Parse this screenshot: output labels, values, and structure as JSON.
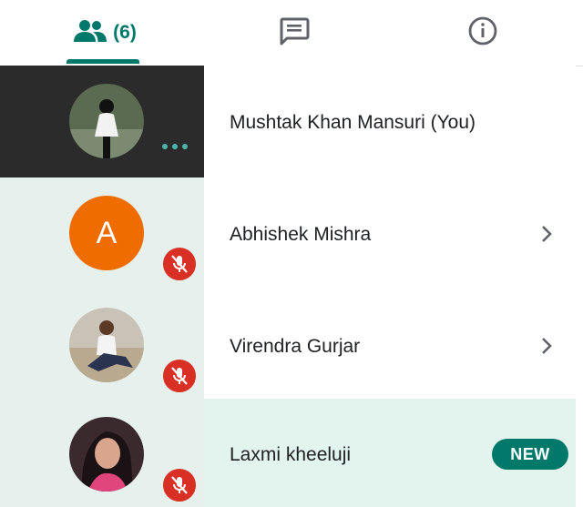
{
  "tabs": {
    "people_count": "(6)",
    "people_icon": "people-icon",
    "chat_icon": "chat-icon",
    "info_icon": "info-icon",
    "active_tab": "people",
    "accent_color": "#00796b"
  },
  "participants": [
    {
      "name": "Mushtak Khan Mansuri (You)",
      "avatar": "photo",
      "status": "more-options"
    },
    {
      "name": "Abhishek Mishra",
      "avatar_letter": "A",
      "avatar_color": "#ef6c00",
      "status": "muted"
    },
    {
      "name": "Virendra Gurjar",
      "avatar": "photo",
      "status": "muted"
    },
    {
      "name": "Laxmi kheeluji",
      "avatar": "photo",
      "status": "muted",
      "badge": "NEW"
    }
  ],
  "colors": {
    "mute_badge": "#d93025",
    "self_row_bg": "#2b2b2b",
    "left_column_bg": "#e6f0ed",
    "new_row_bg": "#e3f4ef"
  }
}
